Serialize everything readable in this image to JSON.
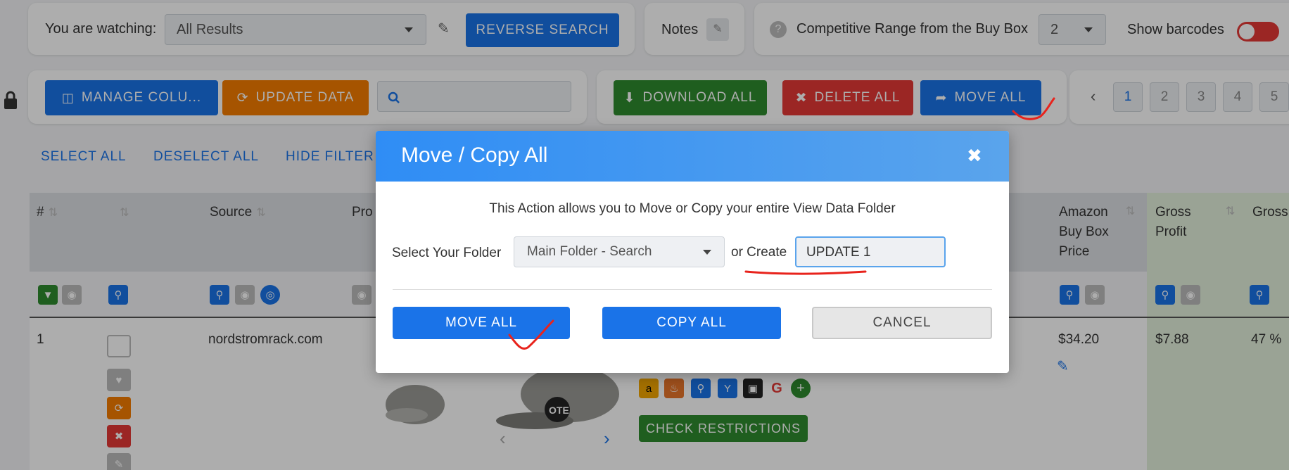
{
  "top_bar": {
    "watching_label": "You are watching:",
    "watching_value": "All Results",
    "reverse_search": "REVERSE SEARCH",
    "notes_label": "Notes",
    "competitive_label": "Competitive Range from the Buy Box",
    "competitive_value": "2",
    "barcodes_label": "Show barcodes"
  },
  "toolbar": {
    "manage_columns": "MANAGE COLU...",
    "update_data": "UPDATE DATA",
    "search_placeholder": "",
    "download_all": "DOWNLOAD ALL",
    "delete_all": "DELETE ALL",
    "move_all": "MOVE ALL"
  },
  "pagination": {
    "pages": [
      "1",
      "2",
      "3",
      "4",
      "5"
    ],
    "active": "1"
  },
  "selection_links": {
    "select_all": "SELECT ALL",
    "deselect_all": "DESELECT ALL",
    "hide_filters": "HIDE FILTER"
  },
  "table": {
    "headers": {
      "num": "#",
      "source": "Source",
      "product": "Pro",
      "amazon_buy_box": "Amazon Buy Box Price",
      "gross_profit": "Gross Profit",
      "gross": "Gross"
    },
    "row": {
      "num": "1",
      "source": "nordstromrack.com",
      "buy_box_price": "$34.20",
      "gross_profit": "$7.88",
      "gross_pct": "47 %",
      "check_restrictions": "CHECK RESTRICTIONS"
    }
  },
  "modal": {
    "title": "Move / Copy All",
    "description": "This Action allows you to Move or Copy your entire View Data Folder",
    "folder_label": "Select Your Folder",
    "folder_value": "Main Folder - Search",
    "or_create": "or Create",
    "create_value": "UPDATE 1",
    "move_all": "MOVE ALL",
    "copy_all": "COPY ALL",
    "cancel": "CANCEL"
  },
  "colors": {
    "primary": "#1a73e8",
    "header_gradient_start": "#2f8df5",
    "header_gradient_end": "#5aa4ec",
    "annotation": "#e8231c"
  }
}
